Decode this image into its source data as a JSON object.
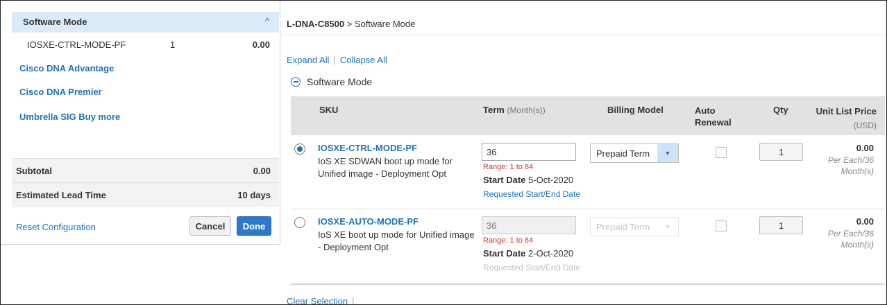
{
  "sidebar": {
    "header": "Software Mode",
    "line_item": {
      "name": "IOSXE-CTRL-MODE-PF",
      "qty": "1",
      "price": "0.00"
    },
    "links": [
      "Cisco DNA Advantage",
      "Cisco DNA Premier",
      "Umbrella SIG Buy more"
    ],
    "subtotal_label": "Subtotal",
    "subtotal_value": "0.00",
    "lead_label": "Estimated Lead Time",
    "lead_value": "10 days",
    "reset_label": "Reset Configuration",
    "cancel_label": "Cancel",
    "done_label": "Done"
  },
  "breadcrumb": {
    "root": "L-DNA-C8500",
    "sep": ">",
    "current": "Software Mode"
  },
  "actions": {
    "expand_all": "Expand All",
    "sep": "|",
    "collapse_all": "Collapse All"
  },
  "section": {
    "title": "Software Mode"
  },
  "table": {
    "headers": {
      "sku": "SKU",
      "term": "Term",
      "term_unit": "(Month(s))",
      "billing": "Billing Model",
      "auto_renewal_1": "Auto",
      "auto_renewal_2": "Renewal",
      "qty": "Qty",
      "unit_price": "Unit List Price",
      "unit_price_currency": "(USD)"
    },
    "rows": [
      {
        "selected": true,
        "sku": "IOSXE-CTRL-MODE-PF",
        "desc": "IoS XE SDWAN boot up mode for Unified image - Deployment Opt",
        "term": "36",
        "range": "Range: 1 to 84",
        "start_label": "Start Date",
        "start_value": "5-Oct-2020",
        "requested": "Requested Start/End Date",
        "billing": "Prepaid Term",
        "auto_renewal": false,
        "qty": "1",
        "price": "0.00",
        "price_unit_1": "Per Each/36",
        "price_unit_2": "Month(s)"
      },
      {
        "selected": false,
        "sku": "IOSXE-AUTO-MODE-PF",
        "desc": "IoS XE boot up mode for Unified image - Deployment Opt",
        "term": "36",
        "range": "Range: 1 to 84",
        "start_label": "Start Date",
        "start_value": "2-Oct-2020",
        "requested": "Requested Start/End Date",
        "billing": "Prepaid Term",
        "auto_renewal": false,
        "qty": "1",
        "price": "0.00",
        "price_unit_1": "Per Each/36",
        "price_unit_2": "Month(s)"
      }
    ]
  },
  "footer": {
    "clear_selection": "Clear Selection",
    "sep": "|"
  },
  "colors": {
    "accent": "#1e73be",
    "header_bg": "#dcebfa",
    "range_red": "#c0392b",
    "done_blue": "#2d7bc8"
  }
}
